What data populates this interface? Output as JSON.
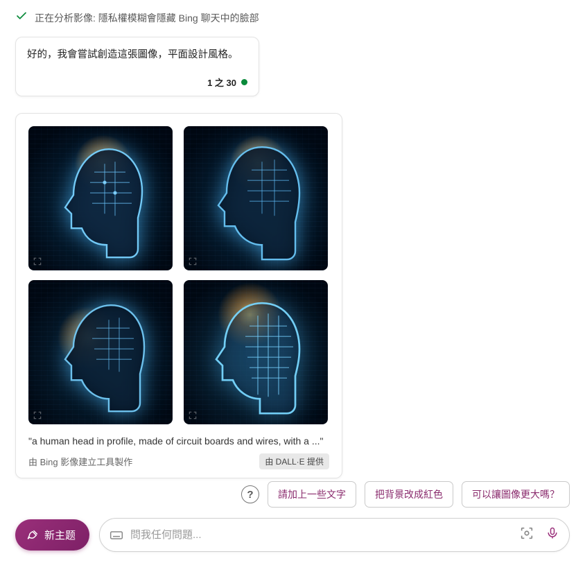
{
  "analyzing": {
    "text": "正在分析影像: 隱私權模糊會隱藏 Bing 聊天中的臉部"
  },
  "reply": {
    "message": "好的，我會嘗試創造這張圖像，平面設計風格。",
    "counter": "1 之 30"
  },
  "imageCard": {
    "prompt": "\"a human head in profile, made of circuit boards and wires, with a ...\"",
    "attribution": "由 Bing 影像建立工具製作",
    "provider": "由 DALL·E 提供",
    "images": [
      "img1",
      "img2",
      "img3",
      "img4"
    ]
  },
  "suggestions": {
    "s1": "請加上一些文字",
    "s2": "把背景改成紅色",
    "s3": "可以讓圖像更大嗎？"
  },
  "bottom": {
    "newTopic": "新主题",
    "placeholder": "問我任何問題..."
  }
}
